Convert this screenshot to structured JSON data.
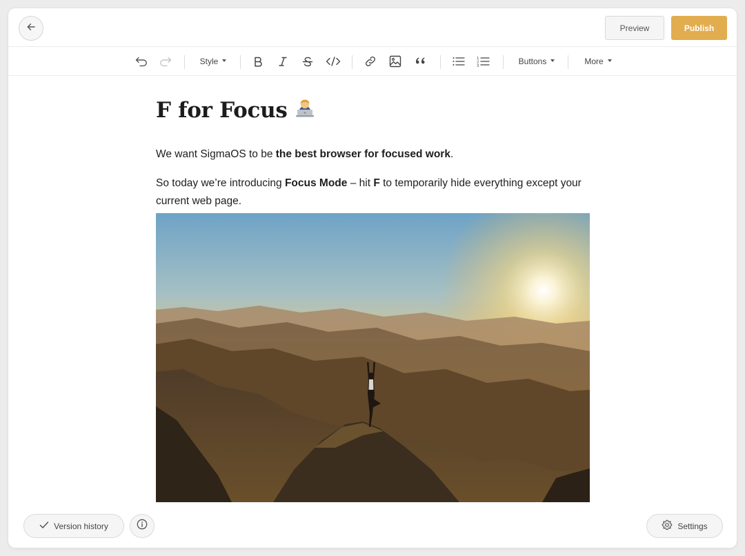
{
  "header": {
    "back_icon": "arrow-left-icon",
    "preview_label": "Preview",
    "publish_label": "Publish",
    "publish_color": "#e2ad4e"
  },
  "toolbar": {
    "style_label": "Style",
    "buttons_label": "Buttons",
    "more_label": "More",
    "icons": [
      "undo-icon",
      "redo-icon",
      "bold-icon",
      "italic-icon",
      "strikethrough-icon",
      "code-icon",
      "link-icon",
      "image-icon",
      "quote-icon",
      "bullet-list-icon",
      "numbered-list-icon"
    ]
  },
  "post": {
    "title": "F for Focus",
    "title_emoji": "technologist-emoji",
    "para1": {
      "prefix": "We want SigmaOS to be ",
      "bold": "the best browser for focused work",
      "suffix": "."
    },
    "para2": {
      "prefix": "So today we’re introducing ",
      "bold1": "Focus Mode",
      "middle": " – hit ",
      "bold2": "F",
      "suffix": " to temporarily hide everything except your current web page."
    },
    "image": "sunset-mountain-yoga-photo"
  },
  "footer": {
    "version_history_label": "Version history",
    "settings_label": "Settings"
  }
}
